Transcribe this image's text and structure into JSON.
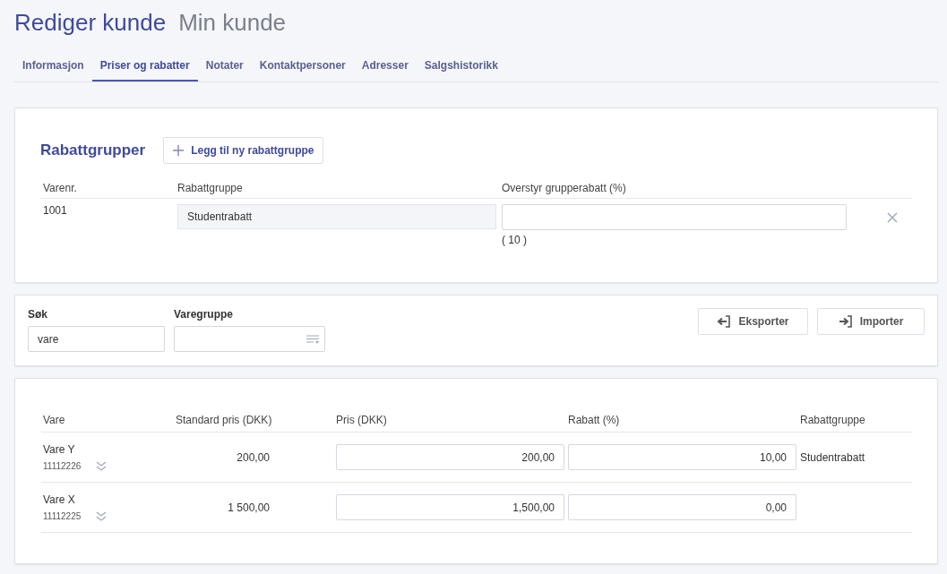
{
  "header": {
    "title": "Rediger kunde",
    "subtitle": "Min kunde"
  },
  "tabs": [
    {
      "label": "Informasjon",
      "selected": false
    },
    {
      "label": "Priser og rabatter",
      "selected": true
    },
    {
      "label": "Notater",
      "selected": false
    },
    {
      "label": "Kontaktpersoner",
      "selected": false
    },
    {
      "label": "Adresser",
      "selected": false
    },
    {
      "label": "Salgshistorikk",
      "selected": false
    }
  ],
  "discount_groups": {
    "title": "Rabattgrupper",
    "add_button": "Legg til ny rabattgruppe",
    "columns": [
      "Varenr.",
      "Rabattgruppe",
      "Overstyr grupperabatt (%)"
    ],
    "rows": [
      {
        "item_no": "1001",
        "group": "Studentrabatt",
        "default_hint": "( 10 )"
      }
    ]
  },
  "filters": {
    "search_label": "Søk",
    "search_value": "vare",
    "group_label": "Varegruppe",
    "export_button": "Eksporter",
    "import_button": "Importer"
  },
  "products": {
    "columns": [
      "Vare",
      "Standard pris (DKK)",
      "Pris (DKK)",
      "Rabatt (%)",
      "Rabattgruppe"
    ],
    "rows": [
      {
        "name": "Vare Y",
        "number": "11112226",
        "standard_price": "200,00",
        "price": "200,00",
        "discount": "10,00",
        "group": "Studentrabatt"
      },
      {
        "name": "Vare X",
        "number": "11112225",
        "standard_price": "1 500,00",
        "price": "1,500,00",
        "discount": "0,00"
      }
    ]
  }
}
